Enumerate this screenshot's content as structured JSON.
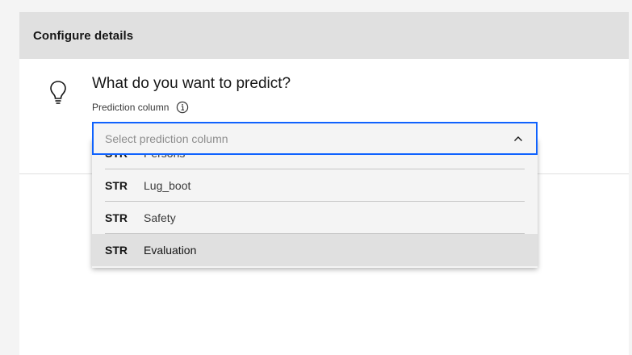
{
  "panel": {
    "title": "Configure details"
  },
  "prediction": {
    "question": "What do you want to predict?",
    "field_label": "Prediction column",
    "select_placeholder": "Select prediction column"
  },
  "icons": {
    "bulb": "lightbulb-icon",
    "info": "information-icon",
    "chevron": "chevron-up-icon"
  },
  "dropdown": {
    "items": [
      {
        "type": "STR",
        "name": "Persons"
      },
      {
        "type": "STR",
        "name": "Lug_boot"
      },
      {
        "type": "STR",
        "name": "Safety"
      },
      {
        "type": "STR",
        "name": "Evaluation"
      }
    ],
    "highlighted_item": "Evaluation"
  },
  "colors": {
    "focus_border": "#0f62fe",
    "header_bg": "#e0e0e0",
    "highlight_bg": "#e0e0e0"
  }
}
